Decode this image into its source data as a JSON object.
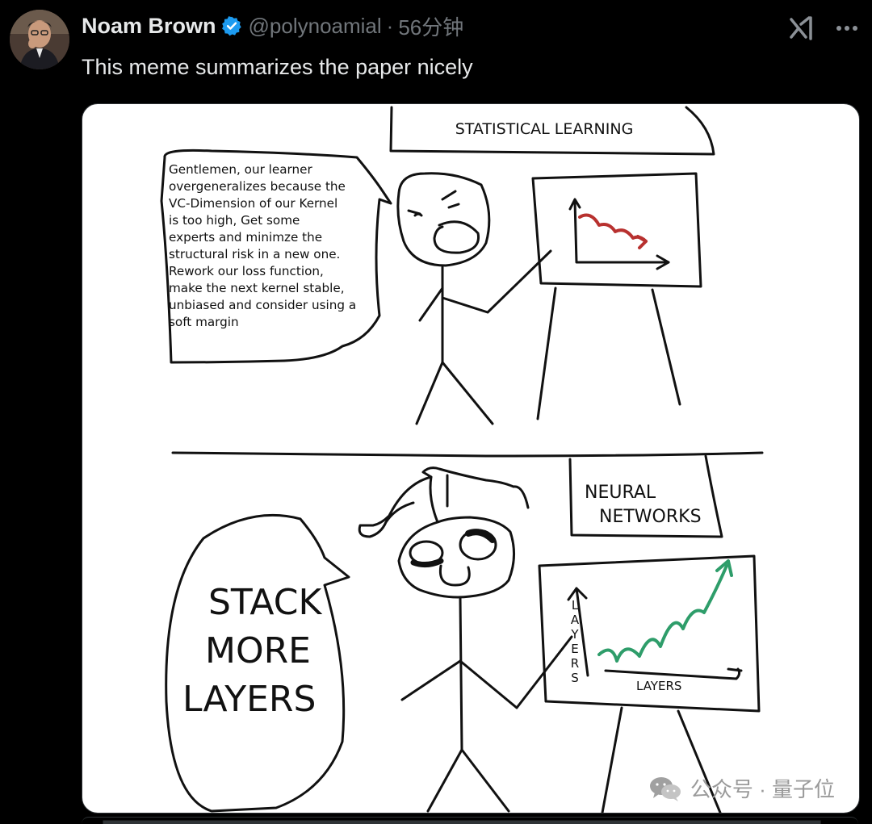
{
  "author": {
    "name": "Noam Brown",
    "handle": "@polynoamial",
    "time": "56分钟"
  },
  "tweet": {
    "text": "This meme summarizes the paper nicely"
  },
  "meme": {
    "top_title": "STATISTICAL LEARNING",
    "top_speech": [
      "Gentlemen, our learner",
      "overgeneralizes because the",
      "VC-Dimension of our Kernel",
      "is too high, Get some",
      "experts and minimze the",
      "structural risk in a new one.",
      "Rework our loss function,",
      "make the next kernel stable,",
      "unbiased and consider using a",
      "soft margin"
    ],
    "bottom_title_line1": "NEURAL",
    "bottom_title_line2": "NETWORKS",
    "bottom_speech": [
      "STACK",
      "MORE",
      "LAYERS"
    ],
    "y_axis_label": "LAYERS",
    "x_axis_label": "LAYERS"
  },
  "watermark": {
    "text": "公众号 · 量子位"
  },
  "icons": {
    "verified": "verified-badge-icon",
    "grok": "grok-icon",
    "more": "more-options-icon",
    "wechat": "wechat-icon"
  },
  "colors": {
    "verified_blue": "#1d9bf0",
    "secondary_text": "#71767b",
    "chart_red": "#b8312f",
    "chart_green": "#2e9d6a"
  }
}
